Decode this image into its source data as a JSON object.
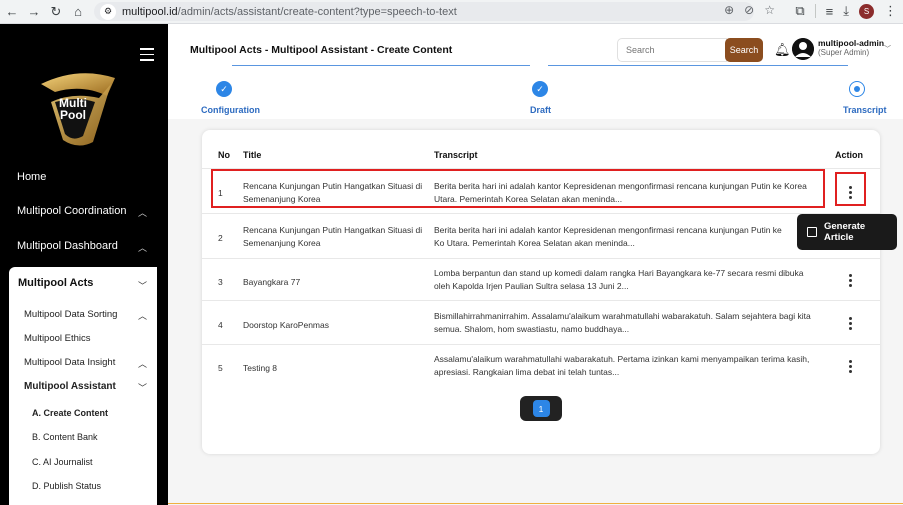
{
  "browser": {
    "url_host": "multipool.id",
    "url_path": "/admin/acts/assistant/create-content?type=speech-to-text",
    "profile_initial": "S"
  },
  "sidebar": {
    "logo_line1": "Multi",
    "logo_line2": "Pool",
    "items": [
      {
        "label": "Home"
      },
      {
        "label": "Multipool Coordination"
      },
      {
        "label": "Multipool Dashboard"
      }
    ],
    "active_group": {
      "label": "Multipool Acts",
      "items": [
        {
          "label": "Multipool Data Sorting"
        },
        {
          "label": "Multipool Ethics"
        },
        {
          "label": "Multipool Data Insight"
        },
        {
          "label": "Multipool Assistant"
        }
      ],
      "sub_items": [
        {
          "label": "A. Create Content"
        },
        {
          "label": "B. Content Bank"
        },
        {
          "label": "C. AI Journalist"
        },
        {
          "label": "D. Publish Status"
        }
      ]
    }
  },
  "header": {
    "title": "Multipool Acts - Multipool Assistant - Create Content",
    "search_placeholder": "Search",
    "search_button": "Search",
    "user_name": "multipool-admin",
    "user_role": "(Super Admin)"
  },
  "stepper": {
    "steps": [
      {
        "label": "Configuration",
        "state": "done"
      },
      {
        "label": "Draft",
        "state": "done"
      },
      {
        "label": "Transcript",
        "state": "current"
      }
    ],
    "accent": "#2d86e6"
  },
  "table": {
    "headers": {
      "no": "No",
      "title": "Title",
      "transcript": "Transcript",
      "action": "Action"
    },
    "rows": [
      {
        "no": "1",
        "title": "Rencana Kunjungan Putin Hangatkan Situasi di Semenanjung Korea",
        "transcript": "Berita berita hari ini adalah kantor Kepresidenan mengonfirmasi rencana kunjungan Putin ke Korea Utara. Pemerintah Korea Selatan akan meninda..."
      },
      {
        "no": "2",
        "title": "Rencana Kunjungan Putin Hangatkan Situasi di Semenanjung Korea",
        "transcript": "Berita berita hari ini adalah kantor Kepresidenan mengonfirmasi rencana kunjungan Putin ke Ko Utara. Pemerintah Korea Selatan akan meninda..."
      },
      {
        "no": "3",
        "title": "Bayangkara 77",
        "transcript": "Lomba berpantun dan stand up komedi dalam rangka Hari Bayangkara ke-77 secara resmi dibuka oleh Kapolda Irjen Paulian Sultra selasa 13 Juni 2..."
      },
      {
        "no": "4",
        "title": "Doorstop KaroPenmas",
        "transcript": "Bismillahirrahmanirrahim. Assalamu'alaikum warahmatullahi wabarakatuh. Salam sejahtera bagi kita semua. Shalom, hom swastiastu, namo buddhaya..."
      },
      {
        "no": "5",
        "title": "Testing 8",
        "transcript": "Assalamu'alaikum warahmatullahi wabarakatuh. Pertama izinkan kami menyampaikan terima kasih, apresiasi. Rangkaian lima debat ini telah tuntas..."
      }
    ]
  },
  "pagination": {
    "current": "1"
  },
  "popup": {
    "label": "Generate Article"
  },
  "colors": {
    "brand": "#8b4d1f",
    "highlight": "#e02020"
  }
}
